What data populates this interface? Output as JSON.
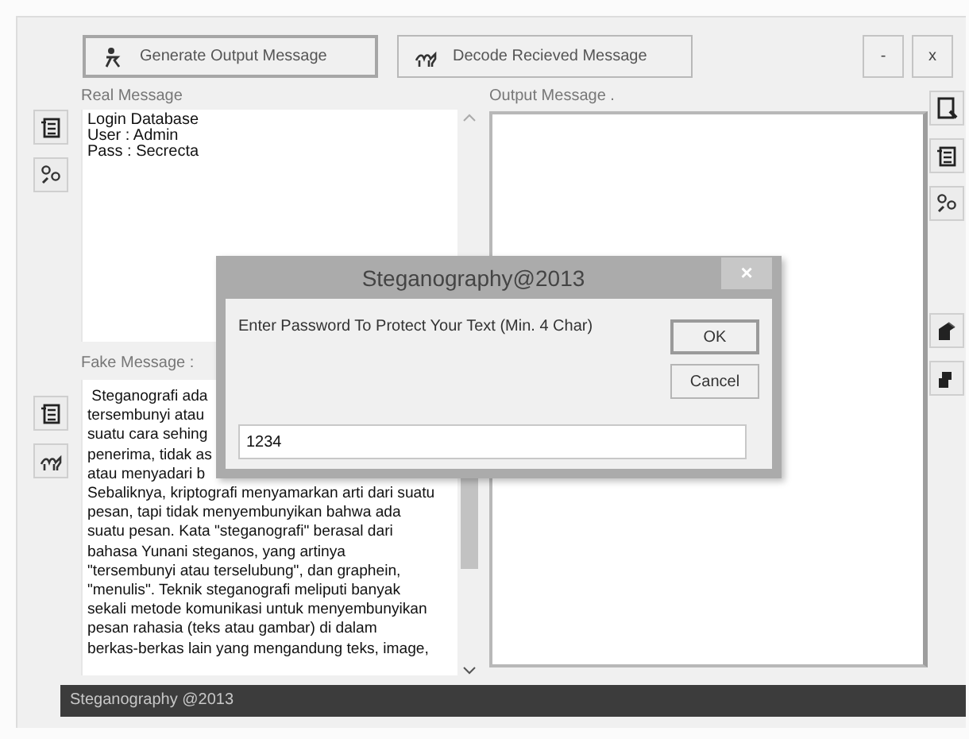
{
  "toolbar": {
    "buttons": [
      {
        "label": "Generate Output Message",
        "selected": true
      },
      {
        "label": "Decode Recieved Message",
        "selected": false
      }
    ],
    "window_buttons": [
      "-",
      "x"
    ]
  },
  "real_message": {
    "label": "Real Message",
    "lines": [
      "Login Database",
      "User : Admin",
      "Pass : Secrecta"
    ]
  },
  "output_message": {
    "label": "Output Message ."
  },
  "fake_message": {
    "label": "Fake Message :",
    "lines": [
      " Steganografi ada",
      "tersembunyi atau",
      "suatu cara sehing",
      "penerima, tidak as",
      "atau menyadari b",
      "Sebaliknya, kriptografi menyamarkan arti dari suatu",
      "pesan, tapi tidak menyembunyikan bahwa ada",
      "suatu pesan. Kata \"steganografi\" berasal dari",
      "bahasa Yunani steganos, yang artinya",
      "\"tersembunyi atau terselubung\", dan graphein,",
      "\"menulis\". Teknik steganografi meliputi banyak",
      "sekali metode komunikasi untuk menyembunyikan",
      "pesan rahasia (teks atau gambar) di dalam",
      "berkas-berkas lain yang mengandung teks, image,"
    ]
  },
  "status_bar": "Steganography @2013",
  "dialog": {
    "title": "Steganography@2013",
    "close": "×",
    "prompt": "Enter Password To Protect Your Text (Min. 4 Char)",
    "value": "1234",
    "buttons": [
      "OK",
      "Cancel"
    ]
  }
}
